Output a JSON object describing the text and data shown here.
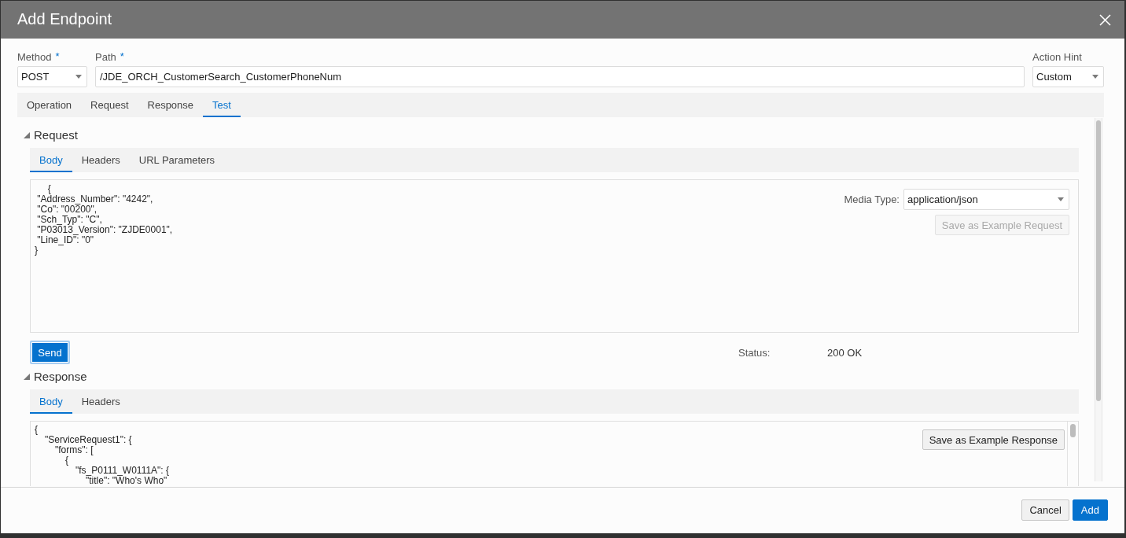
{
  "dialog": {
    "title": "Add Endpoint"
  },
  "fields": [
    {
      "label": "Method",
      "required_mark": "*",
      "kind": "select",
      "value": "POST"
    },
    {
      "label": "Path",
      "required_mark": "*",
      "kind": "text",
      "value": "/JDE_ORCH_CustomerSearch_CustomerPhoneNum"
    },
    {
      "label": "Action Hint",
      "kind": "select",
      "value": "Custom"
    }
  ],
  "tabs": [
    {
      "label": "Operation",
      "selected": false
    },
    {
      "label": "Request",
      "selected": false
    },
    {
      "label": "Response",
      "selected": false
    },
    {
      "label": "Test",
      "selected": true
    }
  ],
  "request": {
    "title": "Request",
    "expanded": true,
    "tabs": [
      {
        "label": "Body",
        "selected": true
      },
      {
        "label": "Headers",
        "selected": false
      },
      {
        "label": "URL Parameters",
        "selected": false
      }
    ],
    "body_lines": [
      "     {",
      " \"Address_Number\": \"4242\",",
      " \"Co\": \"00200\",",
      " \"Sch_Typ\": \"C\",",
      " \"P03013_Version\": \"ZJDE0001\",",
      " \"Line_ID\": \"0\"",
      "}"
    ],
    "media_type": {
      "label": "Media Type:",
      "value": "application/json"
    },
    "save_button": {
      "label": "Save as Example Request",
      "disabled": true
    }
  },
  "send_button": {
    "label": "Send",
    "focused": true
  },
  "status": {
    "label": "Status:",
    "value": "200 OK"
  },
  "response": {
    "title": "Response",
    "expanded": true,
    "tabs": [
      {
        "label": "Body",
        "selected": true
      },
      {
        "label": "Headers",
        "selected": false
      }
    ],
    "body_lines": [
      {
        "text": "{",
        "children": [
          {
            "text": "\"ServiceRequest1\": {",
            "children": [
              {
                "text": "\"forms\": [",
                "children": [
                  {
                    "text": "{",
                    "children": [
                      {
                        "text": "\"fs_P0111_W0111A\": {",
                        "children": [
                          {
                            "text": "\"title\": \"Who's Who\""
                          }
                        ]
                      }
                    ]
                  }
                ]
              }
            ]
          }
        ]
      }
    ],
    "save_button": {
      "label": "Save as Example Response",
      "disabled": false
    }
  },
  "buttons": [
    {
      "label": "Cancel",
      "kind": "secondary"
    },
    {
      "label": "Add",
      "kind": "primary"
    }
  ]
}
